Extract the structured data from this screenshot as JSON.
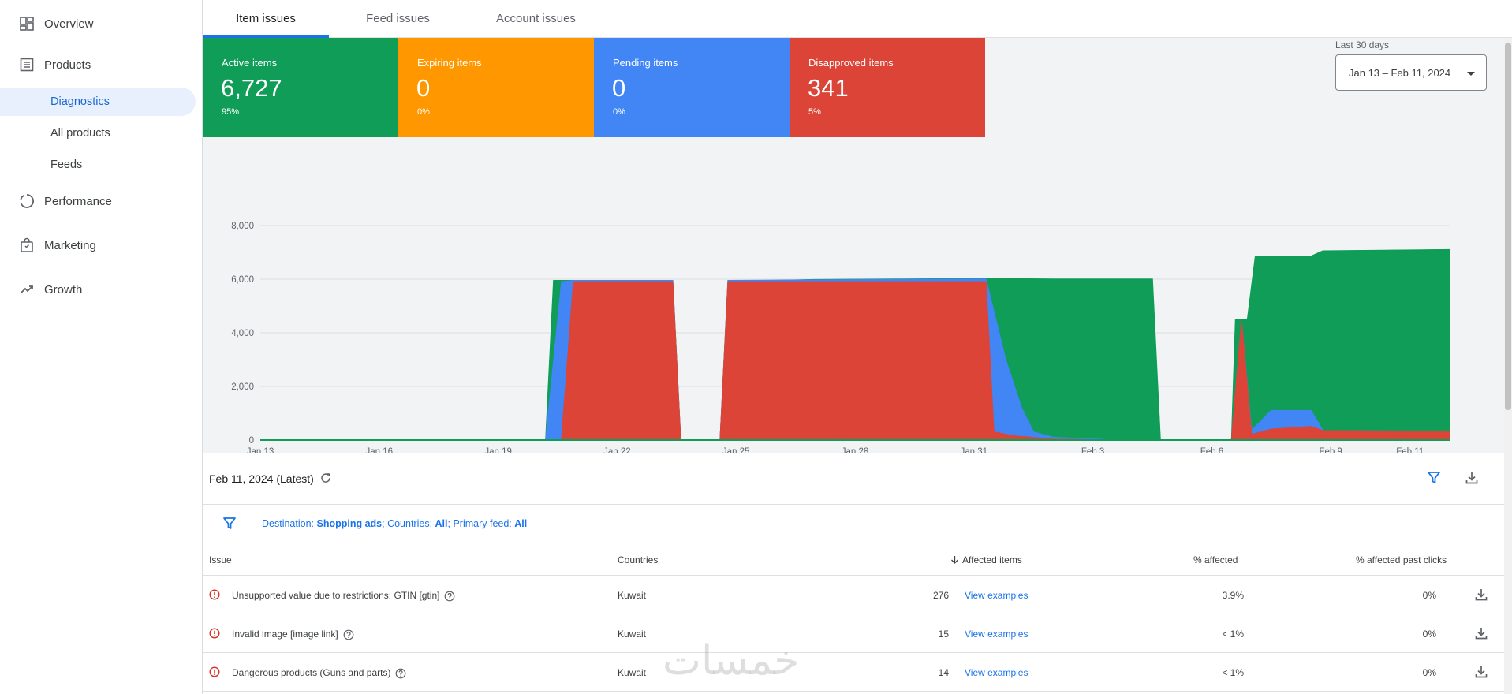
{
  "sidebar": {
    "items": [
      {
        "label": "Overview",
        "icon": "dashboard-icon"
      },
      {
        "label": "Products",
        "icon": "products-icon"
      },
      {
        "label": "Diagnostics"
      },
      {
        "label": "All products"
      },
      {
        "label": "Feeds"
      },
      {
        "label": "Performance",
        "icon": "performance-icon"
      },
      {
        "label": "Marketing",
        "icon": "marketing-icon"
      },
      {
        "label": "Growth",
        "icon": "growth-icon"
      }
    ]
  },
  "tabs": [
    {
      "label": "Item issues",
      "active": true
    },
    {
      "label": "Feed issues",
      "active": false
    },
    {
      "label": "Account issues",
      "active": false
    }
  ],
  "cards": [
    {
      "label": "Active items",
      "value": "6,727",
      "pct": "95%",
      "color": "#0f9d58"
    },
    {
      "label": "Expiring items",
      "value": "0",
      "pct": "0%",
      "color": "#ff9800"
    },
    {
      "label": "Pending items",
      "value": "0",
      "pct": "0%",
      "color": "#4285f4"
    },
    {
      "label": "Disapproved items",
      "value": "341",
      "pct": "5%",
      "color": "#db4437"
    }
  ],
  "date_range": {
    "label": "Last 30 days",
    "value": "Jan 13 – Feb 11, 2024"
  },
  "chart_data": {
    "type": "area",
    "stacked": true,
    "ylim": [
      0,
      8000
    ],
    "yticks": [
      "0",
      "2,000",
      "4,000",
      "6,000",
      "8,000"
    ],
    "xticks": [
      "Jan 13",
      "Jan 16",
      "Jan 19",
      "Jan 22",
      "Jan 25",
      "Jan 28",
      "Jan 31",
      "Feb 3",
      "Feb 6",
      "Feb 9",
      "Feb 11"
    ],
    "grid": true,
    "series": [
      {
        "color": "#db4437",
        "points": [
          [
            0,
            0
          ],
          [
            7,
            0
          ],
          [
            7.2,
            0
          ],
          [
            7.6,
            0
          ],
          [
            7.9,
            5900
          ],
          [
            10.4,
            5900
          ],
          [
            10.6,
            0
          ],
          [
            11.6,
            0
          ],
          [
            11.8,
            5900
          ],
          [
            18.3,
            5900
          ],
          [
            18.5,
            300
          ],
          [
            19,
            150
          ],
          [
            20,
            30
          ],
          [
            21.5,
            0
          ],
          [
            24.5,
            0
          ],
          [
            24.75,
            4400
          ],
          [
            25,
            200
          ],
          [
            25.5,
            400
          ],
          [
            26.5,
            500
          ],
          [
            26.8,
            350
          ],
          [
            30,
            320
          ]
        ]
      },
      {
        "color": "#4285f4",
        "points": [
          [
            0,
            0
          ],
          [
            7,
            0
          ],
          [
            7.2,
            0
          ],
          [
            7.6,
            5900
          ],
          [
            7.9,
            5950
          ],
          [
            10.4,
            5950
          ],
          [
            10.6,
            0
          ],
          [
            11.6,
            0
          ],
          [
            11.8,
            5950
          ],
          [
            18.3,
            6000
          ],
          [
            18.8,
            3000
          ],
          [
            19.2,
            1200
          ],
          [
            19.5,
            300
          ],
          [
            20,
            100
          ],
          [
            21.5,
            0
          ],
          [
            24.5,
            0
          ],
          [
            24.75,
            4400
          ],
          [
            25,
            350
          ],
          [
            25.5,
            1100
          ],
          [
            26.5,
            1100
          ],
          [
            26.8,
            350
          ],
          [
            30,
            320
          ]
        ]
      },
      {
        "color": "#0f9d58",
        "points": [
          [
            0,
            0
          ],
          [
            7,
            0
          ],
          [
            7.2,
            0
          ],
          [
            7.4,
            5950
          ],
          [
            10.4,
            5950
          ],
          [
            10.6,
            0
          ],
          [
            11.6,
            0
          ],
          [
            11.8,
            5950
          ],
          [
            13,
            5950
          ],
          [
            14,
            5980
          ],
          [
            16,
            6000
          ],
          [
            18.3,
            6020
          ],
          [
            20,
            6000
          ],
          [
            22.5,
            6000
          ],
          [
            22.7,
            0
          ],
          [
            24.5,
            0
          ],
          [
            24.6,
            4500
          ],
          [
            24.9,
            4500
          ],
          [
            25.1,
            6850
          ],
          [
            26.5,
            6850
          ],
          [
            26.8,
            7050
          ],
          [
            30,
            7100
          ]
        ]
      }
    ]
  },
  "snapshot": {
    "date": "Feb 11, 2024 (Latest)"
  },
  "filter": {
    "destination_label": "Destination: ",
    "destination_value": "Shopping ads",
    "countries_label": "; Countries: ",
    "countries_value": "All",
    "feed_label": "; Primary feed: ",
    "feed_value": "All"
  },
  "table": {
    "headers": [
      "Issue",
      "Countries",
      "Affected items",
      "% affected",
      "% affected past clicks"
    ],
    "rows": [
      {
        "issue": "Unsupported value due to restrictions: GTIN [gtin]",
        "country": "Kuwait",
        "affected": "276",
        "link": "View examples",
        "pct": "3.9%",
        "clicks": "0%"
      },
      {
        "issue": "Invalid image [image link]",
        "country": "Kuwait",
        "affected": "15",
        "link": "View examples",
        "pct": "< 1%",
        "clicks": "0%"
      },
      {
        "issue": "Dangerous products (Guns and parts)",
        "country": "Kuwait",
        "affected": "14",
        "link": "View examples",
        "pct": "< 1%",
        "clicks": "0%"
      }
    ]
  },
  "watermark": "خمسات"
}
